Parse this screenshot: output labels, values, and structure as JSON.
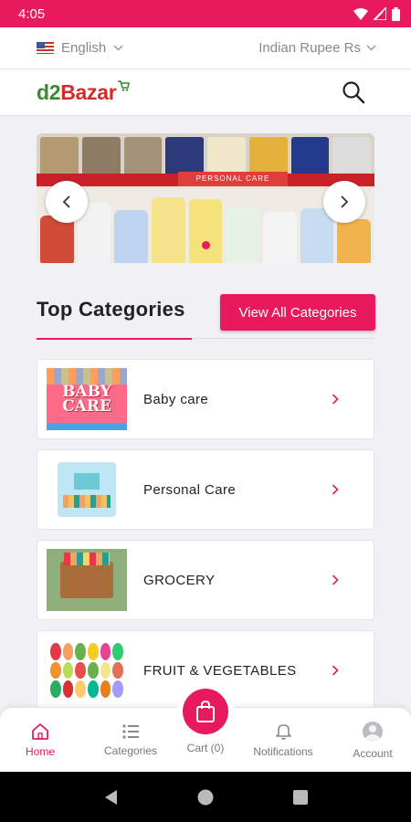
{
  "status_bar": {
    "time": "4:05"
  },
  "top_strip": {
    "language": "English",
    "currency": "Indian Rupee Rs"
  },
  "header": {
    "logo_part1": "d2",
    "logo_part2": "Bazar"
  },
  "banner": {
    "shelf_label": "PERSONAL CARE"
  },
  "section": {
    "title": "Top Categories",
    "view_all_label": "View All Categories"
  },
  "categories": [
    {
      "label": "Baby care",
      "thumb_text": [
        "BABY",
        "CARE"
      ]
    },
    {
      "label": "Personal Care"
    },
    {
      "label": "GROCERY"
    },
    {
      "label": "FRUIT & VEGETABLES"
    }
  ],
  "bottom_nav": {
    "home": "Home",
    "categories": "Categories",
    "cart": "Cart (0)",
    "notifications": "Notifications",
    "account": "Account"
  },
  "colors": {
    "accent": "#e8195c",
    "logo_green": "#3a8a2e",
    "logo_red": "#d22c2c"
  },
  "icons": [
    "wifi-icon",
    "signal-icon",
    "battery-icon",
    "flag-icon",
    "chevron-down-icon",
    "search-icon",
    "chevron-left-icon",
    "chevron-right-icon",
    "home-icon",
    "list-icon",
    "shopping-bag-icon",
    "bell-icon",
    "account-icon",
    "back-icon",
    "home-circle-icon",
    "recents-icon"
  ]
}
